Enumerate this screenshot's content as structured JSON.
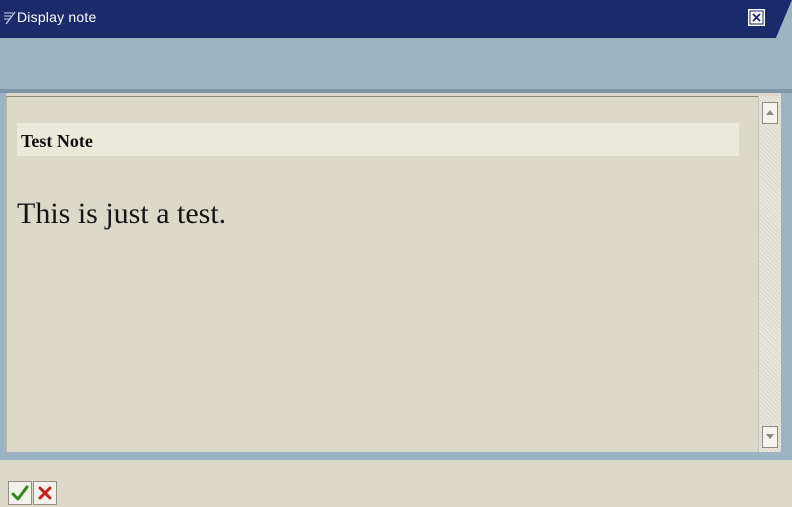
{
  "window": {
    "title": "Display note",
    "title_icon": "note-pencil-icon",
    "close_icon": "close-icon"
  },
  "note": {
    "header": "Test Note",
    "body": "This is just a test."
  },
  "scrollbar": {
    "up_icon": "arrow-up-icon",
    "down_icon": "arrow-down-icon"
  },
  "footer": {
    "confirm_icon": "checkmark-icon",
    "cancel_icon": "cancel-x-icon"
  },
  "colors": {
    "titlebar": "#1b2a6b",
    "toolbar": "#9cb3c2",
    "panel": "#dcd9c8",
    "note_header": "#ebe9da",
    "confirm_green": "#2f8a1c",
    "cancel_red": "#c81e1e"
  }
}
